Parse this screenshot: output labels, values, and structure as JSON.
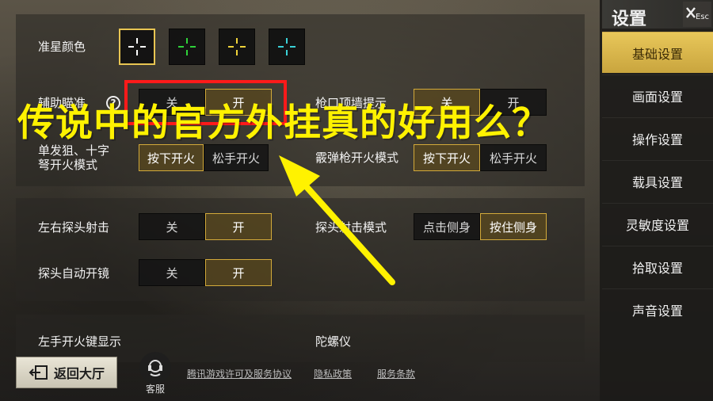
{
  "colors": {
    "accent": "#d3aa3a",
    "active_menu": "#e8c75a",
    "highlight_red": "#ff1a1a",
    "caption_yellow": "#fff200"
  },
  "sidebar": {
    "title": "设置",
    "close_label": "Esc",
    "items": [
      {
        "label": "基础设置",
        "active": true
      },
      {
        "label": "画面设置",
        "active": false
      },
      {
        "label": "操作设置",
        "active": false
      },
      {
        "label": "载具设置",
        "active": false
      },
      {
        "label": "灵敏度设置",
        "active": false
      },
      {
        "label": "拾取设置",
        "active": false
      },
      {
        "label": "声音设置",
        "active": false
      }
    ]
  },
  "settings": {
    "crosshair_color": {
      "label": "准星颜色",
      "options": [
        {
          "color": "#ffffff",
          "selected": true
        },
        {
          "color": "#2fd33a",
          "selected": false
        },
        {
          "color": "#f0d43a",
          "selected": false
        },
        {
          "color": "#3ad2d8",
          "selected": false
        }
      ]
    },
    "aim_assist": {
      "label": "辅助瞄准",
      "off": "关",
      "on": "开",
      "selected": "on"
    },
    "muzzle_wall_hint": {
      "label": "枪口顶墙提示",
      "off": "关",
      "on": "开",
      "selected": "off"
    },
    "sniper_fire_mode": {
      "label_line1": "单发狙、十字",
      "label_line2": "弩开火模式",
      "press": "按下开火",
      "release": "松手开火",
      "selected": "press"
    },
    "shotgun_fire_mode": {
      "label": "霰弹枪开火模式",
      "press": "按下开火",
      "release": "松手开火",
      "selected": "press"
    },
    "peek_fire": {
      "label": "左右探头射击",
      "off": "关",
      "on": "开",
      "selected": "on"
    },
    "peek_mode": {
      "label": "探头射击模式",
      "tap": "点击侧身",
      "hold": "按住侧身",
      "selected": "hold"
    },
    "peek_auto_scope": {
      "label": "探头自动开镜",
      "off": "关",
      "on": "开",
      "selected": "on"
    },
    "left_fire_display": {
      "label": "左手开火键显示"
    },
    "gyroscope": {
      "label": "陀螺仪"
    }
  },
  "footer": {
    "back_label": "返回大厅",
    "service_label": "客服",
    "links": [
      "腾讯游戏许可及服务协议",
      "隐私政策",
      "服务条款"
    ]
  },
  "overlay": {
    "caption": "传说中的官方外挂真的好用么？"
  }
}
